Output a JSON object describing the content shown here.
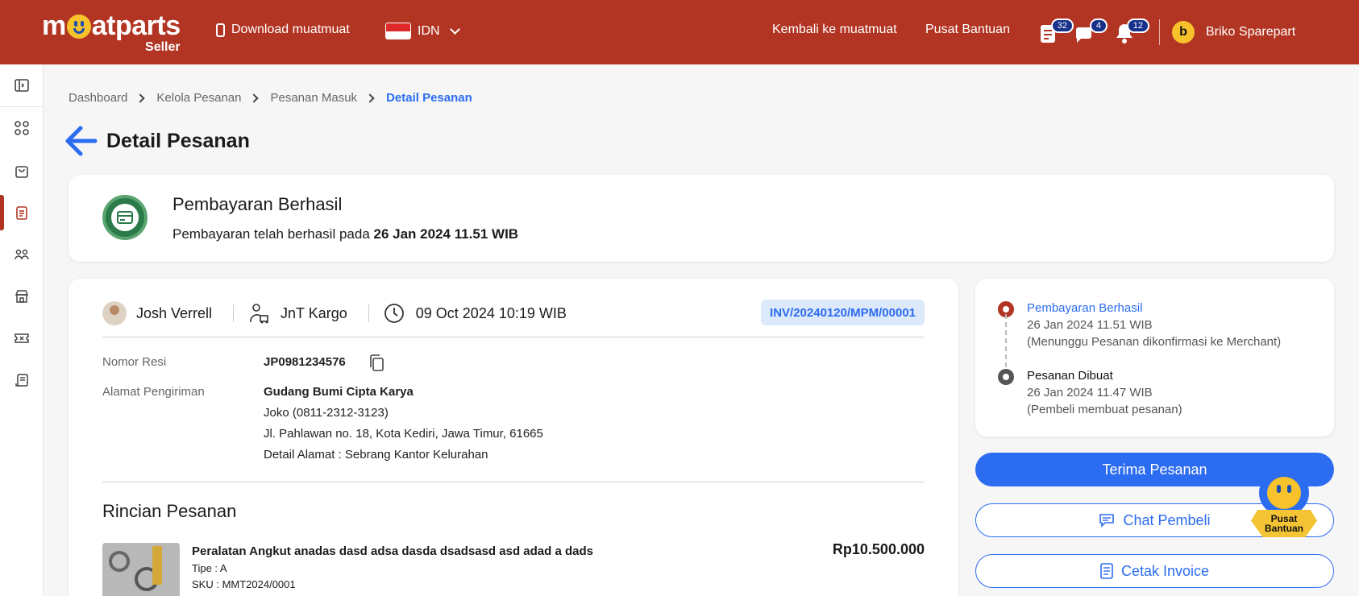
{
  "header": {
    "logo_text": "muatparts",
    "logo_sub": "Seller",
    "download_label": "Download muatmuat",
    "language": "IDN",
    "back_link": "Kembali ke muatmuat",
    "help_link": "Pusat Bantuan",
    "badges": {
      "orders": "32",
      "chat": "4",
      "notifications": "12"
    },
    "user_initial": "b",
    "user_name": "Briko Sparepart"
  },
  "breadcrumb": [
    "Dashboard",
    "Kelola Pesanan",
    "Pesanan Masuk",
    "Detail Pesanan"
  ],
  "page_title": "Detail Pesanan",
  "payment": {
    "title": "Pembayaran Berhasil",
    "subtitle_prefix": "Pembayaran telah berhasil pada",
    "subtitle_date": "26 Jan 2024 11.51 WIB"
  },
  "order": {
    "customer": "Josh Verrell",
    "courier": "JnT Kargo",
    "date": "09 Oct 2024 10:19 WIB",
    "invoice": "INV/20240120/MPM/00001",
    "resi_label": "Nomor Resi",
    "resi_value": "JP0981234576",
    "address_label": "Alamat Pengiriman",
    "address_name": "Gudang Bumi Cipta Karya",
    "address_contact": "Joko (0811-2312-3123)",
    "address_street": "Jl. Pahlawan no. 18, Kota Kediri, Jawa Timur, 61665",
    "address_detail": "Detail Alamat : Sebrang Kantor Kelurahan",
    "section_title": "Rincian Pesanan",
    "product": {
      "name": "Peralatan Angkut anadas dasd adsa dasda dsadsasd asd adad a dads",
      "tipe": "Tipe : A",
      "sku": "SKU : MMT2024/0001",
      "price": "Rp10.500.000"
    }
  },
  "timeline": [
    {
      "title": "Pembayaran Berhasil",
      "date": "26 Jan 2024 11.51 WIB",
      "note": "(Menunggu Pesanan dikonfirmasi ke Merchant)"
    },
    {
      "title": "Pesanan Dibuat",
      "date": "26 Jan 2024 11.47 WIB",
      "note": "(Pembeli membuat pesanan)"
    }
  ],
  "actions": {
    "accept": "Terima Pesanan",
    "chat": "Chat Pembeli",
    "invoice": "Cetak Invoice"
  },
  "help_float": {
    "line1": "Pusat",
    "line2": "Bantuan"
  },
  "colors": {
    "brand": "#b23523",
    "accent": "#2b6cf0",
    "success": "#2b7a4a"
  }
}
